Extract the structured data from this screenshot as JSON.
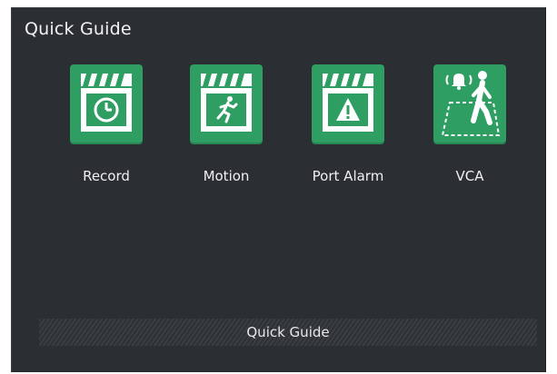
{
  "window": {
    "title": "Quick Guide"
  },
  "items": [
    {
      "label": "Record",
      "icon": "clapper-clock-icon"
    },
    {
      "label": "Motion",
      "icon": "clapper-running-person-icon"
    },
    {
      "label": "Port Alarm",
      "icon": "clapper-warning-icon"
    },
    {
      "label": "VCA",
      "icon": "person-alarm-zone-icon"
    }
  ],
  "footer": {
    "label": "Quick Guide"
  },
  "colors": {
    "background": "#2b2e33",
    "tile": "#2e9e63",
    "text": "#f0f0f0"
  }
}
